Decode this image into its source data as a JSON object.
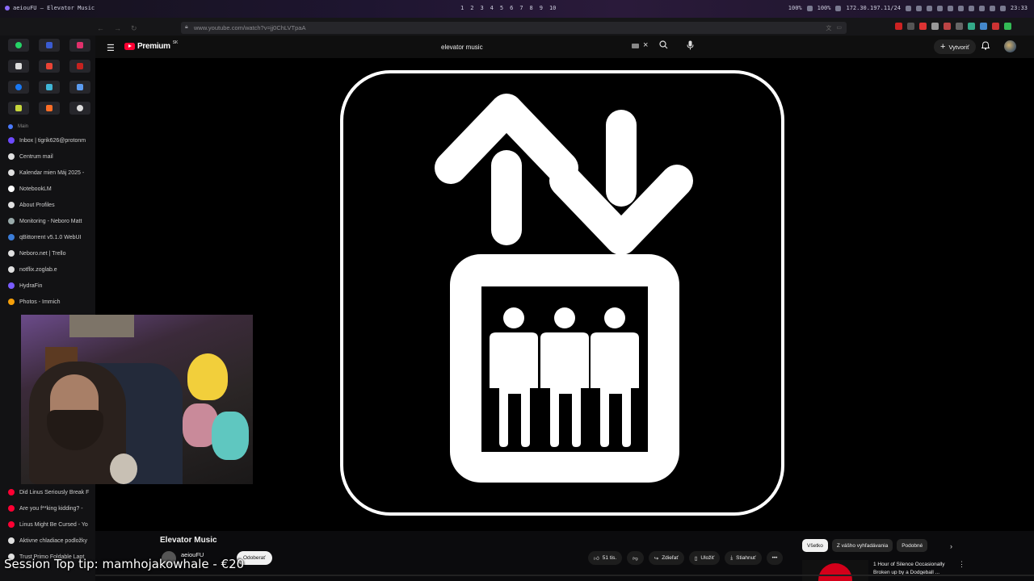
{
  "os": {
    "window_title": "aeiouFU — Elevator Music",
    "workspaces": [
      "1",
      "2",
      "3",
      "4",
      "5",
      "6",
      "7",
      "8",
      "9",
      "10"
    ],
    "status": [
      "100%",
      "100%",
      "172.30.197.11/24"
    ],
    "clock": "23:33"
  },
  "browser": {
    "url": "www.youtube.com/watch?v=jj0ChLVTpaA"
  },
  "sidebar": {
    "group_label": "Main",
    "tabs": [
      {
        "label": "Inbox | tigrik626@protonm",
        "color": "#6d4aff"
      },
      {
        "label": "Centrum mail",
        "color": "#e0e0e0"
      },
      {
        "label": "Kalendar mien Máj 2025 - ",
        "color": "#e0e0e0"
      },
      {
        "label": "NotebookLM",
        "color": "#ffffff"
      },
      {
        "label": "About Profiles",
        "color": "#e0e0e0"
      },
      {
        "label": "Monitoring - Neboro Matt",
        "color": "#9aa"
      },
      {
        "label": "qBittorrent v5.1.0 WebUI",
        "color": "#3b7dd8"
      },
      {
        "label": "Neboro.net | Trello",
        "color": "#e0e0e0"
      },
      {
        "label": "notflix.zoglab.e",
        "color": "#e0e0e0"
      },
      {
        "label": "HydraFin",
        "color": "#7a5cff"
      },
      {
        "label": "Photos - Immich",
        "color": "#f59f0a"
      }
    ],
    "tabs_bottom": [
      {
        "label": "Did Linus Seriously Break F",
        "color": "#ff0033"
      },
      {
        "label": "Are you f**king kidding? - ",
        "color": "#ff0033"
      },
      {
        "label": "Linus Might Be Cursed - Yo",
        "color": "#ff0033"
      },
      {
        "label": "Aktivne chladiace podložky",
        "color": "#e0e0e0"
      },
      {
        "label": "Trust Primo Foldable Lapt",
        "color": "#e0e0e0"
      }
    ]
  },
  "youtube": {
    "logo_text": "Premium",
    "logo_superscript": "SK",
    "search_value": "elevator music",
    "create_label": "Vytvoriť",
    "video_title": "Elevator Music",
    "channel_name": "aeiouFU",
    "subscribe_label": "Odoberať",
    "actions": {
      "like": "51 tis.",
      "share": "Zdieľať",
      "save": "Uložiť",
      "download": "Stiahnuť"
    },
    "chips": [
      "Všetko",
      "Z vášho vyhľadávania",
      "Podobné"
    ],
    "recommendation_title": "1 Hour of Silence Occasionally Broken up by a Dodgeball ..."
  },
  "overlay": {
    "tip": "Session Top tip: mamhojakowhale - €20"
  },
  "colors": {
    "yt_red": "#ff0033",
    "background": "#0f0f0f"
  }
}
